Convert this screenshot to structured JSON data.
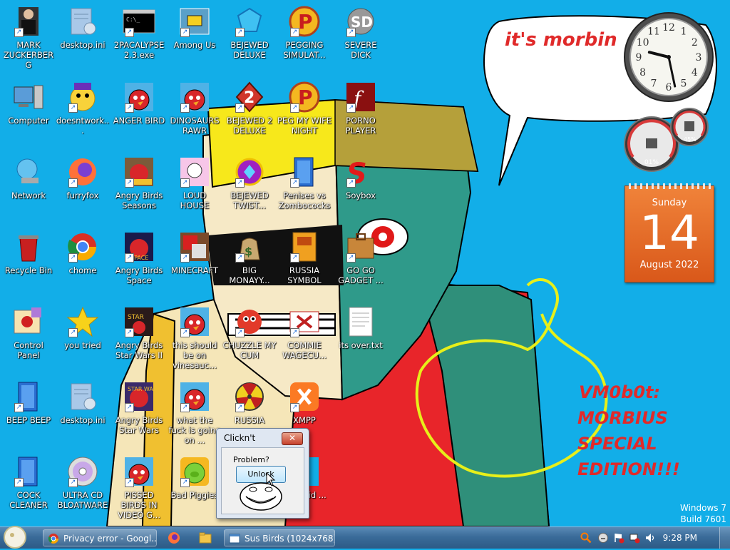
{
  "desktop": {
    "icons": [
      {
        "label": "MARK ZUCKERBERG"
      },
      {
        "label": "desktop.ini"
      },
      {
        "label": "2PACALYPSE 2.3.exe"
      },
      {
        "label": "Among Us"
      },
      {
        "label": "BEJEWED DELUXE"
      },
      {
        "label": "PEGGING SIMULAT..."
      },
      {
        "label": "SEVERE DICK"
      },
      {
        "label": "Computer"
      },
      {
        "label": "doesntwork..."
      },
      {
        "label": "ANGER BIRD"
      },
      {
        "label": "DINOSAURS RAWR"
      },
      {
        "label": "BEJEWED 2 DELUXE"
      },
      {
        "label": "PEG MY WIFE NIGHT"
      },
      {
        "label": "PORNO PLAYER"
      },
      {
        "label": "Network"
      },
      {
        "label": "furryfox"
      },
      {
        "label": "Angry Birds Seasons"
      },
      {
        "label": "LOUD HOUSE"
      },
      {
        "label": "BEJEWED TWIST..."
      },
      {
        "label": "Penises vs Zombococks"
      },
      {
        "label": "Soybox"
      },
      {
        "label": "Recycle Bin"
      },
      {
        "label": "chome"
      },
      {
        "label": "Angry Birds Space"
      },
      {
        "label": "MINECRAFT"
      },
      {
        "label": "BIG MONAYY..."
      },
      {
        "label": "RUSSIA SYMBOL"
      },
      {
        "label": "GO GO GADGET ..."
      },
      {
        "label": "Control Panel"
      },
      {
        "label": "you tried"
      },
      {
        "label": "Angry Birds Star Wars II"
      },
      {
        "label": "this should be on vinesauc..."
      },
      {
        "label": "CHUZZLE MY CUM"
      },
      {
        "label": "COMMIE WAGECU..."
      },
      {
        "label": "its over.txt"
      },
      {
        "label": "BEEP BEEP"
      },
      {
        "label": "desktop.ini"
      },
      {
        "label": "Angry Birds Star Wars"
      },
      {
        "label": "what the fuck is going on ..."
      },
      {
        "label": "RUSSIA"
      },
      {
        "label": "XMPP"
      },
      {
        "label": "COCK CLEANER"
      },
      {
        "label": "ULTRA CD BLOATWARE"
      },
      {
        "label": "PISSED BIRDS IN VIDEO G..."
      },
      {
        "label": "Bad Piggies"
      },
      {
        "label": "l are pid ..."
      }
    ],
    "wallpaper_text": {
      "speech": "it's morbin",
      "title_line1": "VM0b0t:",
      "title_line2": "MORBIUS",
      "title_line3": "SPECIAL",
      "title_line4": "EDITION!!!"
    },
    "windows_version": {
      "line1": "Windows 7",
      "line2": "Build 7601"
    }
  },
  "gadgets": {
    "clock": {
      "hour": 9,
      "minute": 28,
      "numerals": [
        "12",
        "1",
        "2",
        "3",
        "4",
        "5",
        "6",
        "7",
        "8",
        "9",
        "10",
        "11"
      ]
    },
    "cpu_meter": {
      "cpu_percent": "01%",
      "memory_percent": "45%",
      "cpu_value": 0.01,
      "memory_value": 0.45
    },
    "calendar": {
      "weekday": "Sunday",
      "day": "14",
      "month_year": "August 2022"
    }
  },
  "dialog": {
    "title": "Clickn't",
    "close": "✕",
    "message": "Problem?",
    "button": "Unlock"
  },
  "taskbar": {
    "items": [
      {
        "label": "Privacy error - Googl..."
      },
      {
        "label": "Sus Birds (1024x768)"
      }
    ],
    "clock": "9:28 PM"
  },
  "colors": {
    "desktop": "#12aee8",
    "taskbar": "#3a6b99",
    "calendar": "#e8692a"
  }
}
